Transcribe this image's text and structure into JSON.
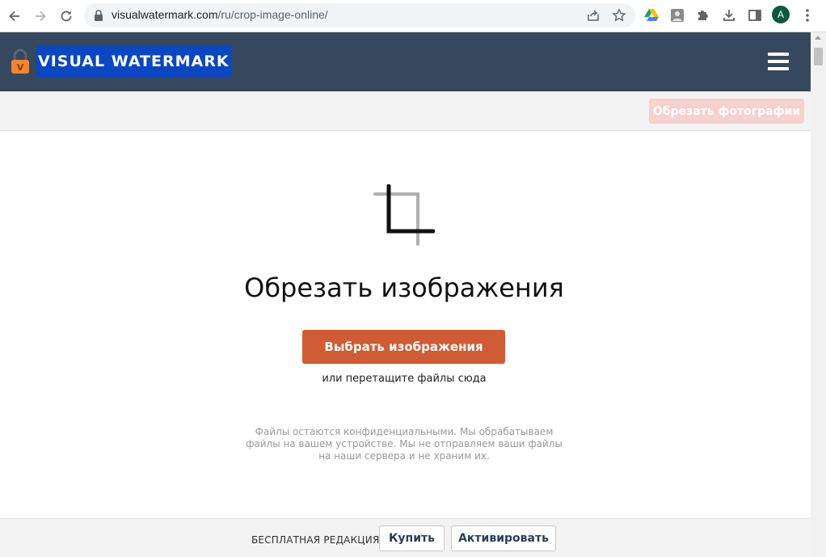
{
  "browser": {
    "url_host": "visualwatermark.com",
    "url_path": "/ru/crop-image-online/",
    "avatar_letter": "A",
    "icons": [
      "back-icon",
      "forward-icon",
      "reload-icon",
      "lock-icon",
      "share-icon",
      "star-icon",
      "google-drive-icon",
      "extension-photo-icon",
      "puzzle-icon",
      "download-icon",
      "side-panel-icon",
      "more-icon"
    ]
  },
  "header": {
    "logo_text": "VISUAL WATERMARK",
    "logo_letter": "V",
    "colors": {
      "bg": "#36485d",
      "logo_bg": "#0a47c2"
    }
  },
  "subbar": {
    "crop_photos_label": "Обрезать фотографии"
  },
  "main": {
    "title": "Обрезать изображения",
    "select_button": "Выбрать изображения",
    "drop_hint": "или перетащите файлы сюда",
    "privacy_line1": "Файлы остаются конфиденциальными. Мы обрабатываем",
    "privacy_line2": "файлы на вашем устройстве. Мы не отправляем ваши файлы",
    "privacy_line3": "на наши сервера и не храним их.",
    "colors": {
      "accent": "#d05b34"
    }
  },
  "footer": {
    "edition_label": "БЕСПЛАТНАЯ РЕДАКЦИЯ",
    "buy_label": "Купить",
    "activate_label": "Активировать"
  }
}
